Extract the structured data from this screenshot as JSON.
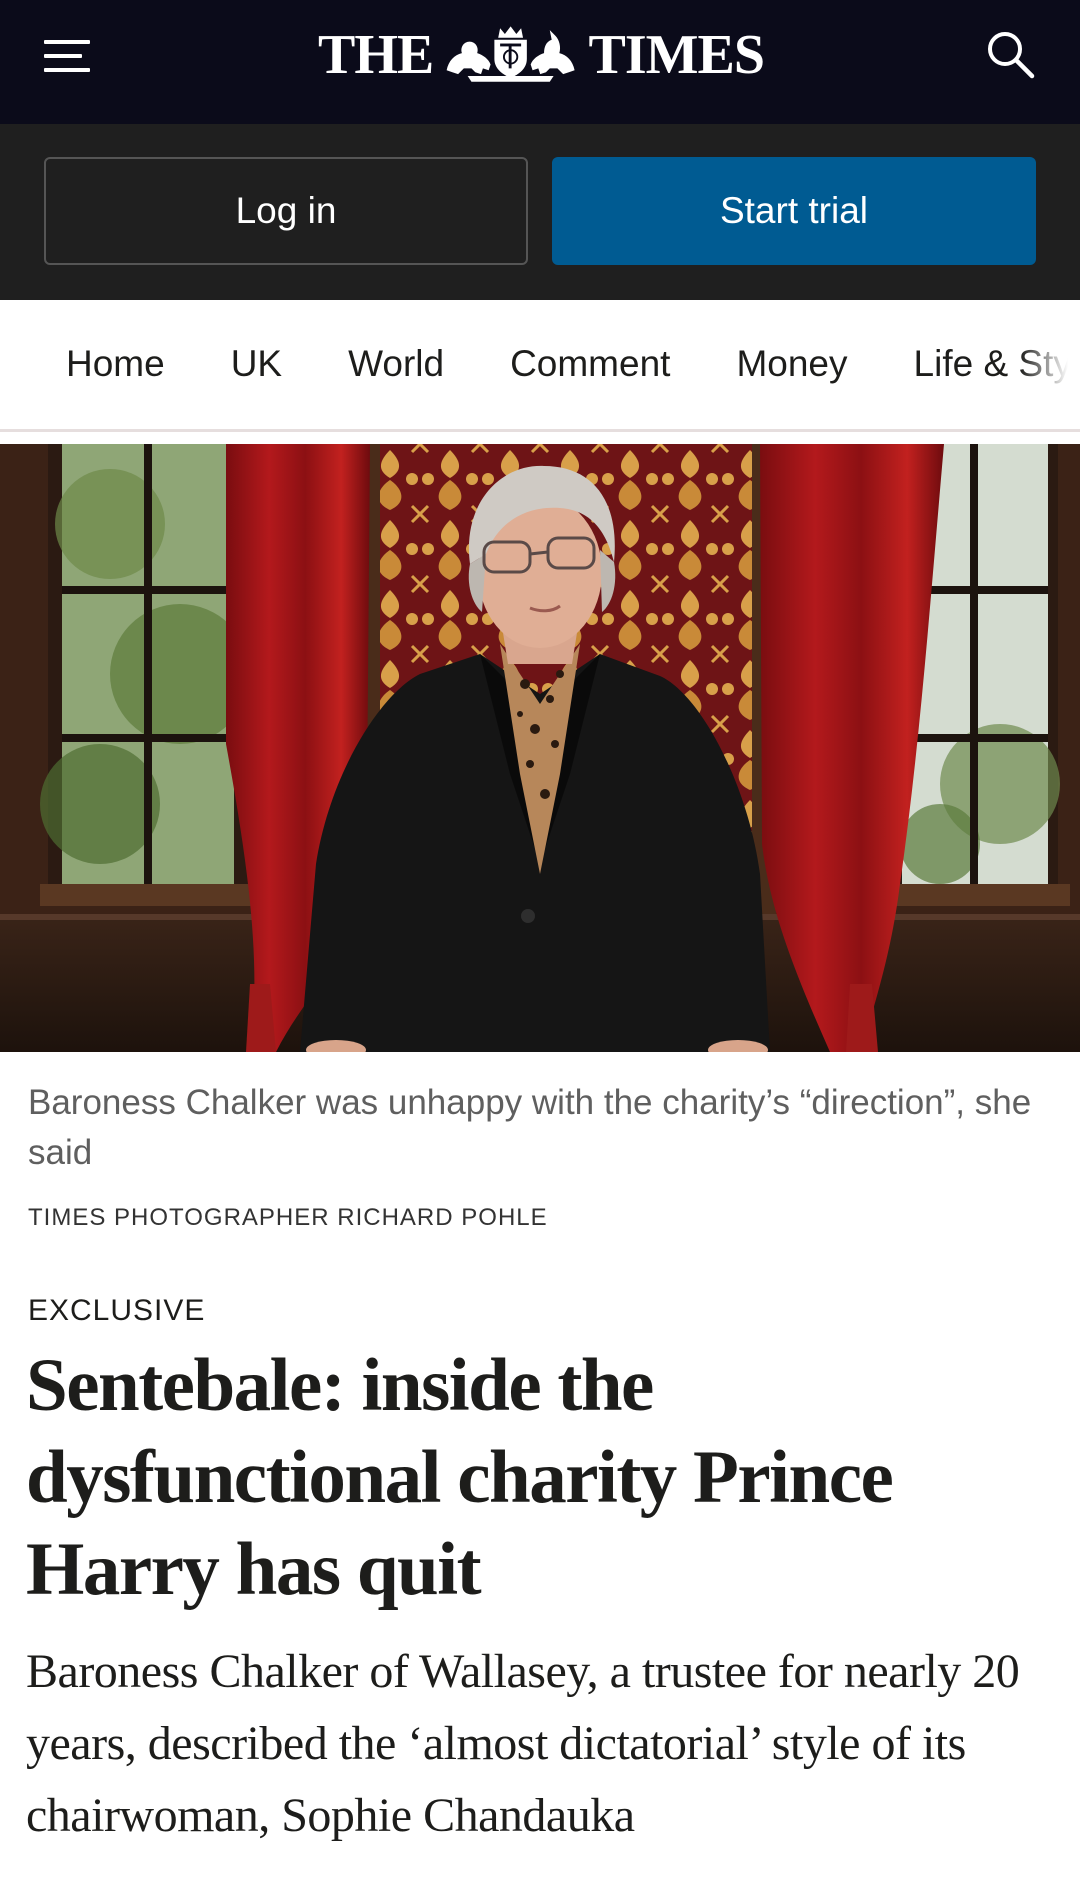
{
  "masthead": {
    "logo_left": "THE",
    "logo_right": "TIMES",
    "background": "#0b0b1a",
    "menu_icon": "hamburger-menu-icon",
    "search_icon": "search-icon"
  },
  "account": {
    "login_label": "Log in",
    "trial_label": "Start trial",
    "trial_color": "#005b92"
  },
  "nav": {
    "items": [
      "Home",
      "UK",
      "World",
      "Comment",
      "Money",
      "Life & Style"
    ]
  },
  "photo": {
    "caption": "Baroness Chalker was unhappy with the charity’s “direction”, she said",
    "credit": "TIMES PHOTOGRAPHER RICHARD POHLE"
  },
  "article": {
    "kicker": "EXCLUSIVE",
    "headline": "Sentebale: inside the dysfunctional charity Prince Harry has quit",
    "standfirst": "Baroness Chalker of Wallasey, a trustee for nearly 20 years, described the ‘almost dictatorial’ style of its chairwoman, Sophie Chandauka"
  }
}
